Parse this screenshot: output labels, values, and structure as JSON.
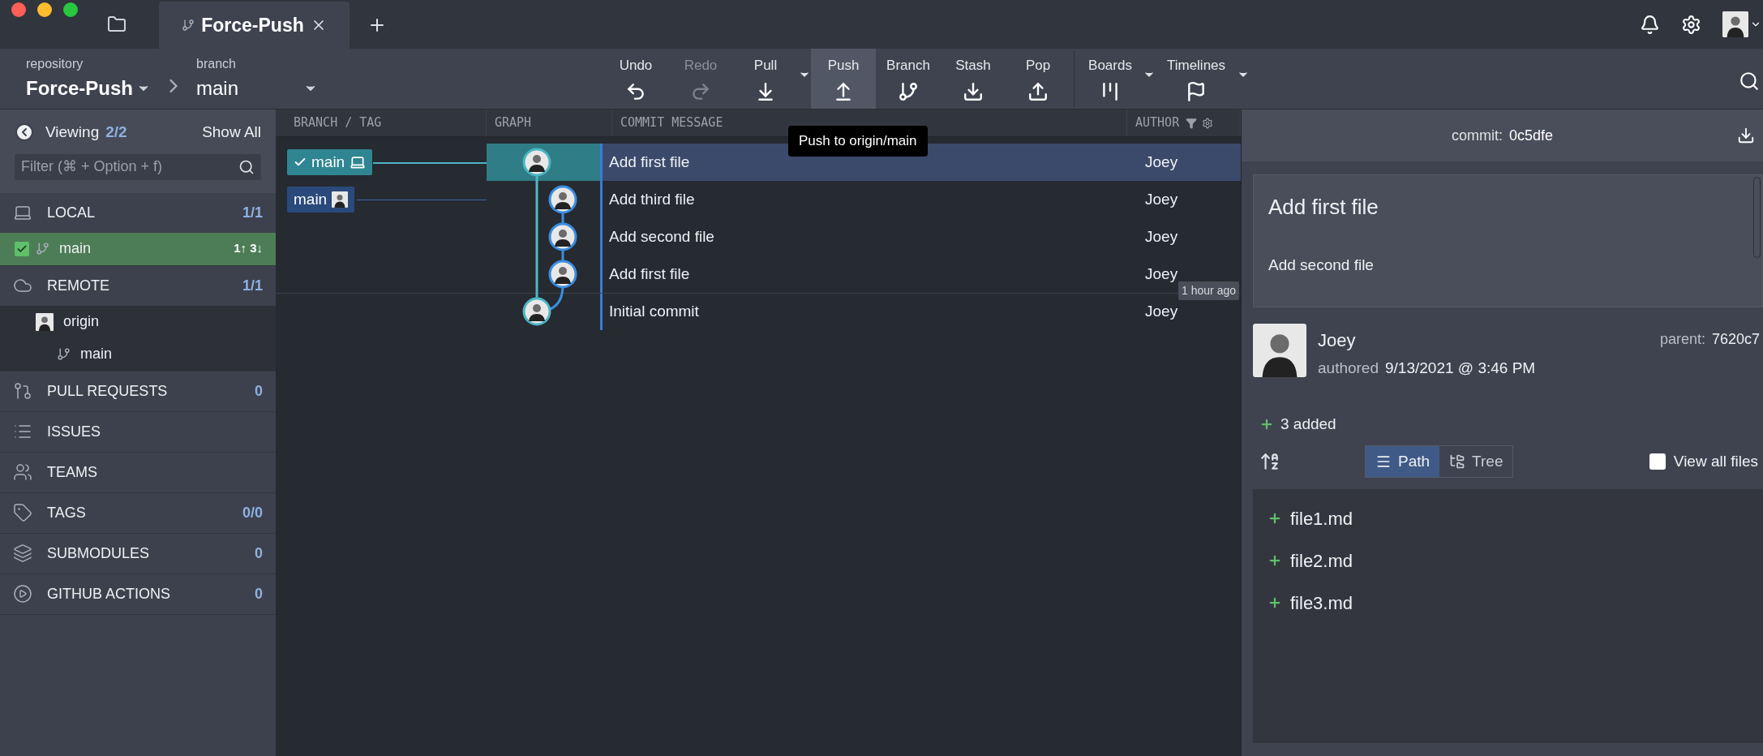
{
  "window": {
    "tabs": [
      {
        "label": "Force-Push",
        "selected": true
      }
    ]
  },
  "toolbar": {
    "repository_label": "repository",
    "repository": "Force-Push",
    "branch_label": "branch",
    "branch": "main",
    "actions": [
      {
        "kind": "undo",
        "label": "Undo",
        "disabled": false,
        "selected": false,
        "menu": false
      },
      {
        "kind": "redo",
        "label": "Redo",
        "disabled": true,
        "selected": false,
        "menu": false
      },
      {
        "kind": "pull",
        "label": "Pull",
        "disabled": false,
        "selected": false,
        "menu": true
      },
      {
        "kind": "push",
        "label": "Push",
        "disabled": false,
        "selected": true,
        "menu": false
      },
      {
        "kind": "branch",
        "label": "Branch",
        "disabled": false,
        "selected": false,
        "menu": false
      },
      {
        "kind": "stash",
        "label": "Stash",
        "disabled": false,
        "selected": false,
        "menu": false
      },
      {
        "kind": "pop",
        "label": "Pop",
        "disabled": false,
        "selected": false,
        "menu": false
      },
      {
        "kind": "boards",
        "label": "Boards",
        "disabled": false,
        "selected": false,
        "menu": true
      },
      {
        "kind": "timelines",
        "label": "Timelines",
        "disabled": false,
        "selected": false,
        "menu": true
      }
    ],
    "tooltip": "Push to origin/main"
  },
  "sidebar": {
    "viewing_label": "Viewing",
    "viewing_count": "2/2",
    "show_all": "Show All",
    "filter": {
      "placeholder": "Filter (⌘ + Option + f)"
    },
    "sections": [
      {
        "kind": "local",
        "label": "LOCAL",
        "count": "1/1",
        "children": [
          {
            "kind": "branch",
            "label": "main",
            "checked": true,
            "ahead_behind": "1↑ 3↓"
          }
        ]
      },
      {
        "kind": "remote",
        "label": "REMOTE",
        "count": "1/1",
        "children": [
          {
            "kind": "remote",
            "label": "origin",
            "children": [
              {
                "kind": "branch",
                "label": "main"
              }
            ]
          }
        ]
      },
      {
        "kind": "pull_requests",
        "label": "PULL REQUESTS",
        "count": "0"
      },
      {
        "kind": "issues",
        "label": "ISSUES"
      },
      {
        "kind": "teams",
        "label": "TEAMS"
      },
      {
        "kind": "tags",
        "label": "TAGS",
        "count": "0/0"
      },
      {
        "kind": "submodules",
        "label": "SUBMODULES",
        "count": "0"
      },
      {
        "kind": "actions",
        "label": "GITHUB ACTIONS",
        "count": "0"
      }
    ]
  },
  "graph": {
    "columns": [
      "BRANCH / TAG",
      "GRAPH",
      "COMMIT MESSAGE",
      "AUTHOR"
    ],
    "commits": [
      {
        "message": "Add first file",
        "author": "Joey",
        "selected": true,
        "kind": "main",
        "branch_label": {
          "label": "main",
          "kind": "local",
          "checked": true
        }
      },
      {
        "message": "Add third file",
        "author": "Joey",
        "selected": false,
        "kind": "side",
        "branch_label": {
          "label": "main",
          "kind": "remote",
          "checked": false
        }
      },
      {
        "message": "Add second file",
        "author": "Joey",
        "selected": false,
        "kind": "side"
      },
      {
        "message": "Add first file",
        "author": "Joey",
        "selected": false,
        "kind": "side",
        "time": "1 hour ago"
      },
      {
        "message": "Initial commit",
        "author": "Joey",
        "selected": false,
        "kind": "main"
      }
    ]
  },
  "detail": {
    "commit_label": "commit:",
    "sha": "0c5dfe",
    "summary": "Add first file",
    "body": "Add second file",
    "author": "Joey",
    "authored_label": "authored",
    "date": "9/13/2021 @ 3:46 PM",
    "parent_label": "parent:",
    "parent": "7620c7",
    "added": "3 added",
    "views": [
      {
        "kind": "path",
        "label": "Path",
        "selected": true
      },
      {
        "kind": "tree",
        "label": "Tree",
        "selected": false
      }
    ],
    "view_all": {
      "label": "View all files",
      "checked": false
    },
    "files": [
      {
        "name": "file1.md",
        "kind": "added"
      },
      {
        "name": "file2.md",
        "kind": "added"
      },
      {
        "name": "file3.md",
        "kind": "added"
      }
    ]
  }
}
